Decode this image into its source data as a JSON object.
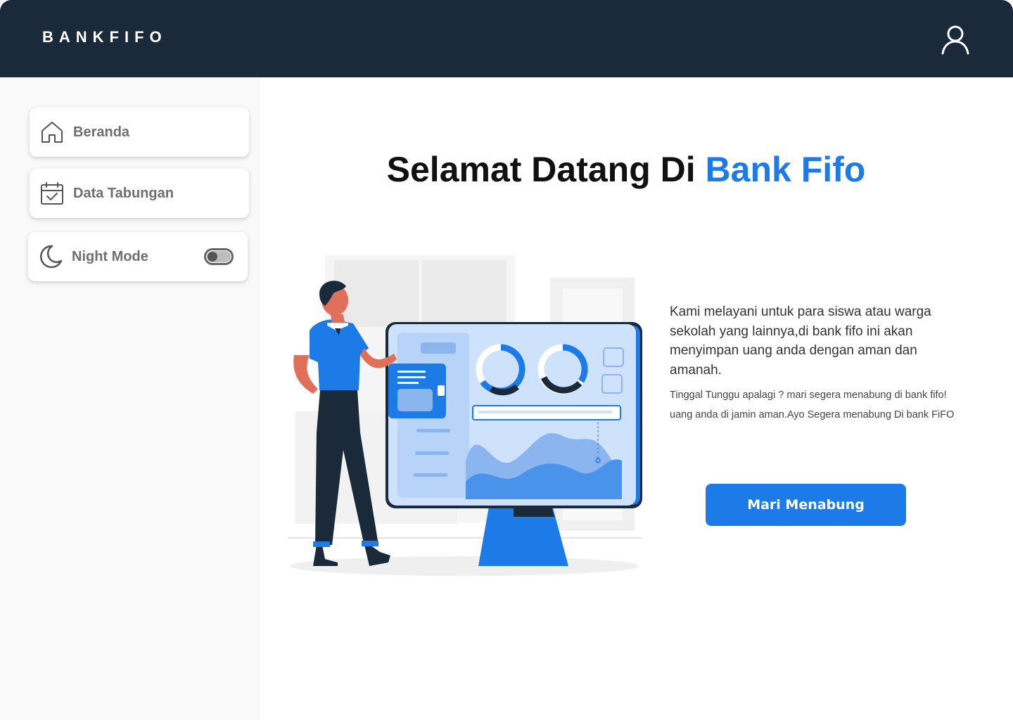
{
  "header": {
    "brand": "BANKFIFO",
    "profile_icon": "user-icon"
  },
  "sidebar": {
    "items": [
      {
        "label": "Beranda",
        "icon": "home-icon"
      },
      {
        "label": "Data Tabungan",
        "icon": "calendar-check-icon"
      }
    ],
    "night_mode": {
      "label": "Night Mode",
      "icon": "moon-icon",
      "enabled": false
    }
  },
  "main": {
    "headline_prefix": "Selamat Datang Di ",
    "headline_accent": "Bank Fifo",
    "description": "Kami melayani untuk para siswa atau warga sekolah yang lainnya,di bank fifo ini akan menyimpan uang anda dengan aman dan amanah.",
    "subtext": "Tinggal Tunggu apalagi ? mari segera menabung di bank fifo! uang anda di jamin aman.Ayo Segera menabung Di bank FiFO",
    "cta_label": "Mari Menabung",
    "illustration": "man-presenting-dashboard-illustration"
  },
  "colors": {
    "header_bg": "#1b2a3b",
    "accent": "#1c7be6",
    "sidebar_bg": "#f9f9f9"
  }
}
